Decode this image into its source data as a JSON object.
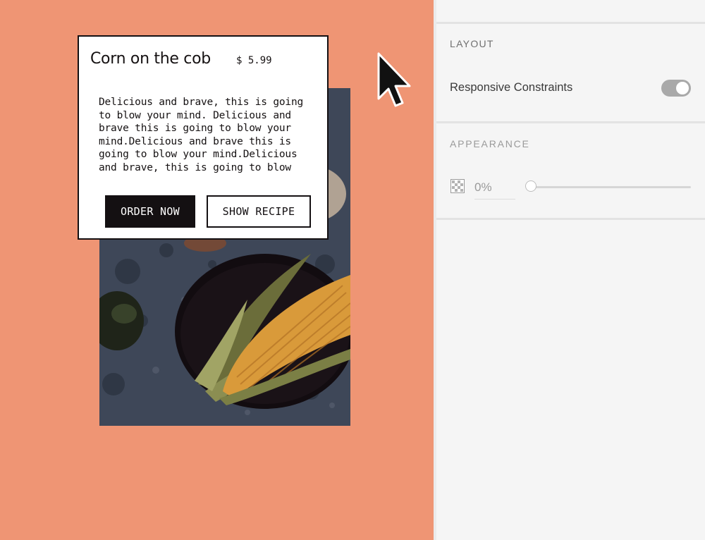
{
  "card": {
    "title": "Corn on the cob",
    "price": "$ 5.99",
    "description": "Delicious and brave, this is going\nto blow your mind. Delicious and\nbrave this is going to blow your\nmind.Delicious and brave this is\ngoing to blow your mind.Delicious\nand brave, this is going to blow",
    "order_label": "ORDER NOW",
    "recipe_label": "SHOW RECIPE"
  },
  "panel": {
    "layout_title": "LAYOUT",
    "responsive_label": "Responsive Constraints",
    "responsive_on": true,
    "appearance_title": "APPEARANCE",
    "opacity_value": "0%",
    "opacity_fraction": 0
  },
  "icons": {
    "cursor": "arrow-cursor-icon",
    "opacity": "checkerboard-opacity-icon"
  },
  "colors": {
    "canvas_bg": "#ef9574",
    "panel_bg": "#f5f5f5",
    "ink": "#141012"
  }
}
